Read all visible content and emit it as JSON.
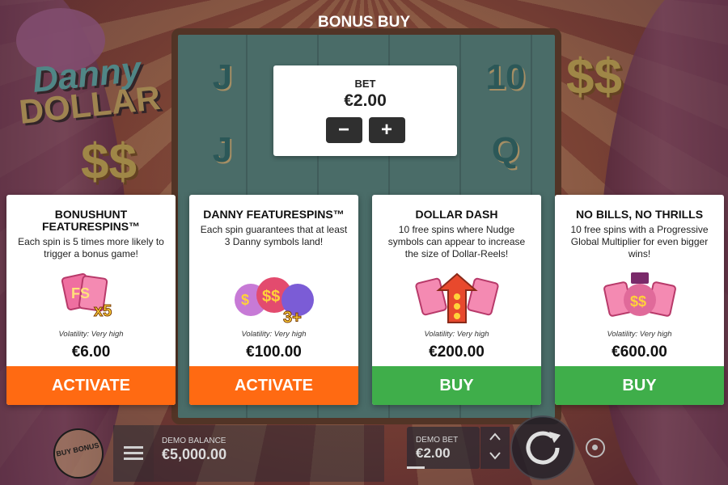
{
  "title": "BONUS BUY",
  "logo": {
    "line1": "Danny",
    "line2": "DOLLAR"
  },
  "reel_symbols": [
    "J",
    "10",
    "J",
    "Q"
  ],
  "bet": {
    "label": "BET",
    "value": "€2.00",
    "decrease_label": "−",
    "increase_label": "+"
  },
  "cards": [
    {
      "title": "BONUSHUNT FEATURESPINS™",
      "description": "Each spin is 5 times more likely to trigger a bonus game!",
      "badge": "x5",
      "volatility": "Volatility: Very high",
      "price": "€6.00",
      "action": "ACTIVATE",
      "action_color": "#ff6a12"
    },
    {
      "title": "DANNY FEATURESPINS™",
      "description": "Each spin guarantees that at least 3 Danny symbols land!",
      "badge": "3+",
      "volatility": "Volatility: Very high",
      "price": "€100.00",
      "action": "ACTIVATE",
      "action_color": "#ff6a12"
    },
    {
      "title": "DOLLAR DASH",
      "description": "10 free spins where Nudge symbols can appear to increase the size of Dollar-Reels!",
      "badge": "",
      "volatility": "Volatility: Very high",
      "price": "€200.00",
      "action": "BUY",
      "action_color": "#3fae4a"
    },
    {
      "title": "NO BILLS, NO THRILLS",
      "description": "10 free spins with a Progressive Global Multiplier for even bigger wins!",
      "badge": "",
      "volatility": "Volatility: Very high",
      "price": "€600.00",
      "action": "BUY",
      "action_color": "#3fae4a"
    }
  ],
  "bottom_bar": {
    "buy_bonus_label": "BUY BONUS",
    "balance_label": "DEMO BALANCE",
    "balance_value": "€5,000.00",
    "bet_label": "DEMO BET",
    "bet_value": "€2.00"
  },
  "icons": {
    "menu": "menu-icon",
    "spin": "spin-icon",
    "autoplay": "autoplay-icon",
    "arrow_up": "chevron-up-icon",
    "arrow_down": "chevron-down-icon"
  }
}
